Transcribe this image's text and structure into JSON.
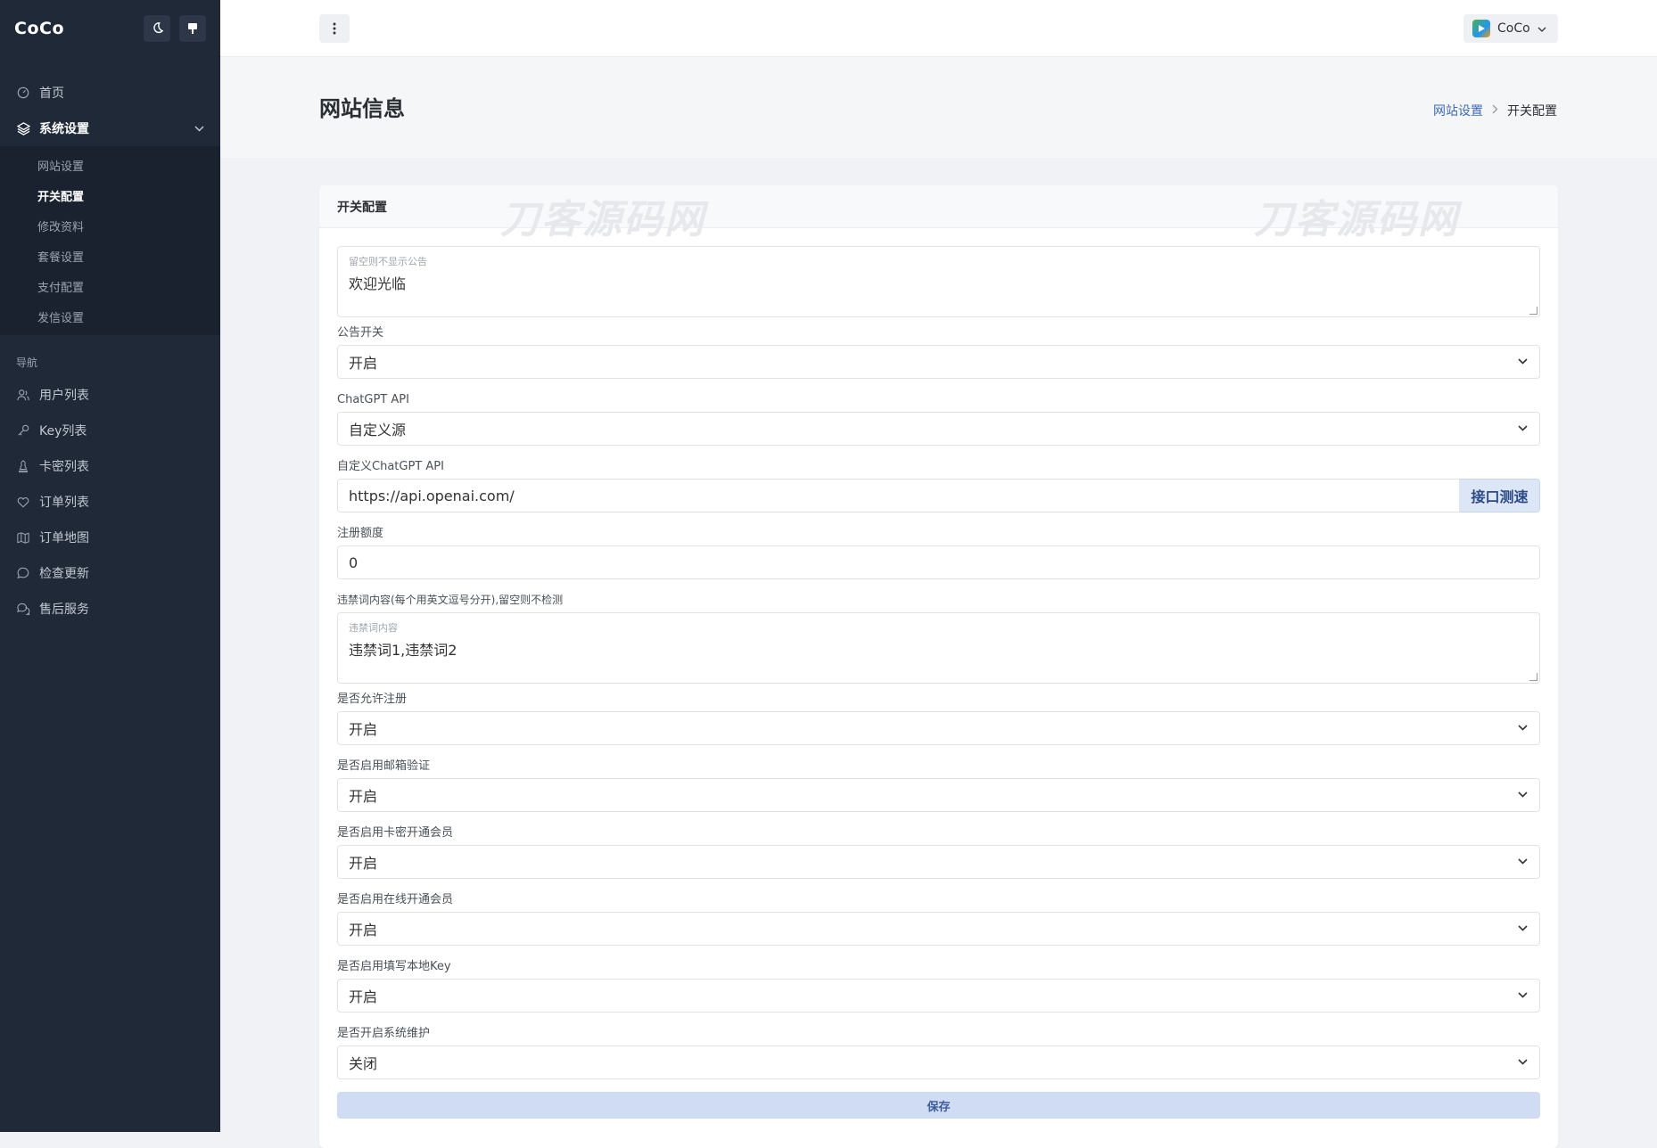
{
  "sidebar": {
    "brand": "CoCo",
    "menu": [
      {
        "label": "首页",
        "icon": "dashboard-icon"
      },
      {
        "label": "系统设置",
        "icon": "layers-icon"
      }
    ],
    "submenu": [
      "网站设置",
      "开关配置",
      "修改资料",
      "套餐设置",
      "支付配置",
      "发信设置"
    ],
    "section_title": "导航",
    "nav": [
      {
        "label": "用户列表",
        "icon": "users-icon"
      },
      {
        "label": "Key列表",
        "icon": "key-icon"
      },
      {
        "label": "卡密列表",
        "icon": "chess-icon"
      },
      {
        "label": "订单列表",
        "icon": "heart-icon"
      },
      {
        "label": "订单地图",
        "icon": "map-icon"
      },
      {
        "label": "检查更新",
        "icon": "chat-icon"
      },
      {
        "label": "售后服务",
        "icon": "chats-icon"
      }
    ]
  },
  "topbar": {
    "user_name": "CoCo"
  },
  "page": {
    "title": "网站信息",
    "breadcrumb": [
      "网站设置",
      "开关配置"
    ]
  },
  "card": {
    "title": "开关配置",
    "watermark": "刀客源码网"
  },
  "form": {
    "notice": {
      "placeholder": "留空则不显示公告",
      "value": "欢迎光临"
    },
    "notice_switch": {
      "label": "公告开关",
      "value": "开启"
    },
    "chatgpt_api": {
      "label": "ChatGPT API",
      "value": "自定义源"
    },
    "custom_api": {
      "label": "自定义ChatGPT API",
      "value": "https://api.openai.com/",
      "button": "接口测速"
    },
    "register_quota": {
      "label": "注册额度",
      "value": "0"
    },
    "banned_words": {
      "label": "违禁词内容(每个用英文逗号分开),留空则不检测",
      "placeholder": "违禁词内容",
      "value": "违禁词1,违禁词2"
    },
    "allow_register": {
      "label": "是否允许注册",
      "value": "开启"
    },
    "email_verify": {
      "label": "是否启用邮箱验证",
      "value": "开启"
    },
    "card_member": {
      "label": "是否启用卡密开通会员",
      "value": "开启"
    },
    "online_member": {
      "label": "是否启用在线开通会员",
      "value": "开启"
    },
    "local_key": {
      "label": "是否启用填写本地Key",
      "value": "开启"
    },
    "maintenance": {
      "label": "是否开启系统维护",
      "value": "关闭"
    },
    "save": "保存"
  }
}
